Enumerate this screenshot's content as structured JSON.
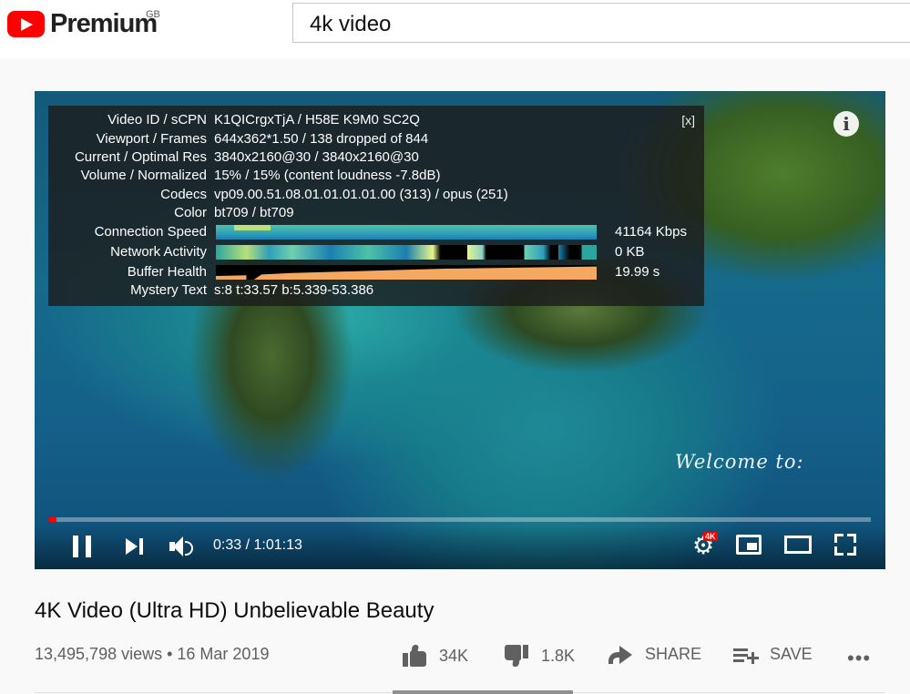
{
  "header": {
    "logo_text": "Premium",
    "region": "GB",
    "search_value": "4k video"
  },
  "player": {
    "stats": {
      "close_label": "[x]",
      "rows": [
        {
          "label": "Video ID / sCPN",
          "value": "K1QICrgxTjA / H58E K9M0 SC2Q"
        },
        {
          "label": "Viewport / Frames",
          "value": "644x362*1.50 / 138 dropped of 844"
        },
        {
          "label": "Current / Optimal Res",
          "value": "3840x2160@30 / 3840x2160@30"
        },
        {
          "label": "Volume / Normalized",
          "value": "15% / 15% (content loudness -7.8dB)"
        },
        {
          "label": "Codecs",
          "value": "vp09.00.51.08.01.01.01.01.00 (313) / opus (251)"
        },
        {
          "label": "Color",
          "value": "bt709 / bt709"
        }
      ],
      "graphs": [
        {
          "label": "Connection Speed",
          "value": "41164 Kbps"
        },
        {
          "label": "Network Activity",
          "value": "0 KB"
        },
        {
          "label": "Buffer Health",
          "value": "19.99 s"
        }
      ],
      "mystery": {
        "label": "Mystery Text",
        "value": "s:8 t:33.57 b:5.339-53.386"
      }
    },
    "info_icon": "i",
    "overlay_text": "Welcome to:",
    "progress_fraction": 0.009,
    "time_display": "0:33 / 1:01:13",
    "quality_badge": "4K",
    "gear_glyph": "⚙",
    "icons": [
      "pause-icon",
      "next-icon",
      "volume-icon",
      "settings-icon",
      "miniplayer-icon",
      "theater-icon",
      "fullscreen-icon"
    ]
  },
  "video": {
    "title": "4K Video (Ultra HD) Unbelievable Beauty",
    "meta": "13,495,798 views • 16 Mar 2019",
    "likes": "34K",
    "dislikes": "1.8K",
    "share_label": "SHARE",
    "save_label": "SAVE",
    "more_label": "•••"
  },
  "colors": {
    "brand_red": "#ff0000",
    "progress_red": "#ff0000",
    "muted_text": "#606060"
  }
}
